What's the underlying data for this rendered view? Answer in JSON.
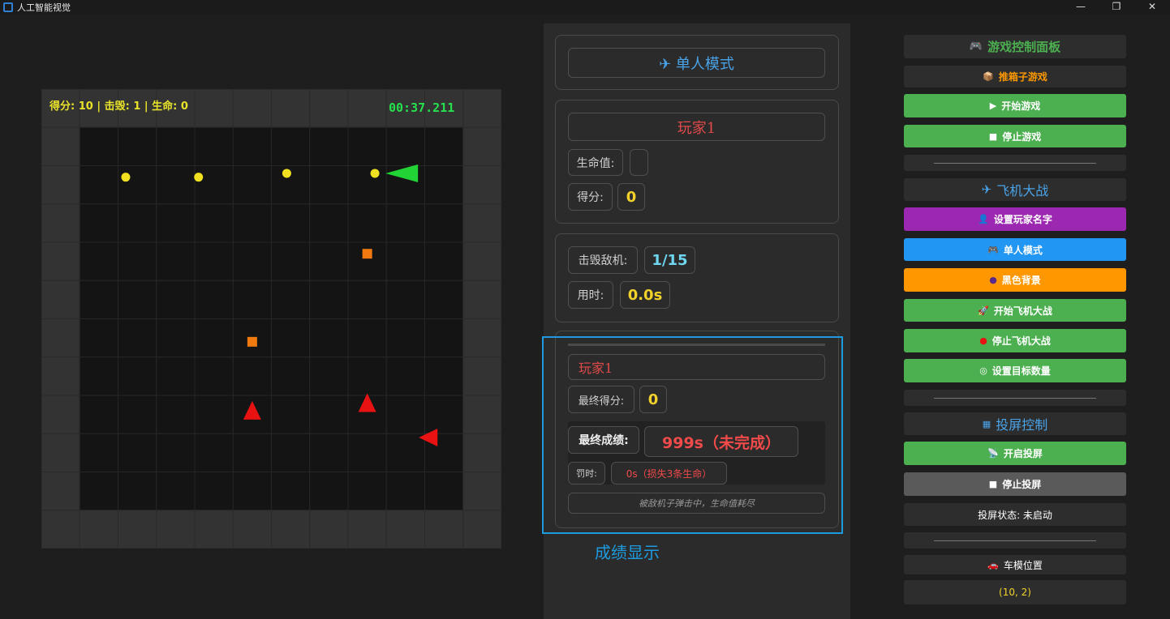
{
  "window": {
    "title": "人工智能视觉",
    "controls": [
      "—",
      "❐",
      "✕"
    ]
  },
  "hud": {
    "score_text": "得分: 10 | 击毁: 1 | 生命: 0",
    "timer": "00:37.211"
  },
  "game": {
    "grid_cells": 12,
    "player_ship": {
      "col": 9.4,
      "row": 2.2,
      "color": "#22d335",
      "facing": "left"
    },
    "yellow_bullets": [
      {
        "col": 2.2,
        "row": 2.3
      },
      {
        "col": 4.1,
        "row": 2.3
      },
      {
        "col": 6.4,
        "row": 2.2
      },
      {
        "col": 8.7,
        "row": 2.2
      }
    ],
    "orange_blocks": [
      {
        "col": 8.5,
        "row": 4.3
      },
      {
        "col": 5.5,
        "row": 6.6
      }
    ],
    "red_enemies": [
      {
        "col": 5.5,
        "row": 8.4,
        "facing": "up"
      },
      {
        "col": 8.5,
        "row": 8.2,
        "facing": "up"
      },
      {
        "col": 10.1,
        "row": 9.1,
        "facing": "left"
      }
    ],
    "colors": {
      "cell_dark": "#141414",
      "cell_border": "#333333",
      "outer": "#333333",
      "bullet": "#f0e020",
      "block": "#f07a10",
      "enemy": "#e81212"
    }
  },
  "mode_card": {
    "title": "✈ 单人模式"
  },
  "player_card": {
    "name": "玩家1",
    "hp_label": "生命值:",
    "hp_value": "",
    "score_label": "得分:",
    "score_value": "0"
  },
  "stats_card": {
    "kills_label": "击毁敌机:",
    "kills_value": "1/15",
    "time_label": "用时:",
    "time_value": "0.0s"
  },
  "result_card": {
    "name": "玩家1",
    "final_score_label": "最终得分:",
    "final_score_value": "0",
    "final_result_label": "最终成绩:",
    "final_result_value": "999s（未完成）",
    "penalty_label": "罚时:",
    "penalty_value": "0s（损失3条生命）",
    "note": "被敌机子弹击中，生命值耗尽"
  },
  "caption": "成绩显示",
  "right_panel": {
    "game_control_title": "游戏控制面板",
    "sokoban": "推箱子游戏",
    "start_game": "开始游戏",
    "stop_game": "停止游戏",
    "plane_war_title": "飞机大战",
    "set_player_name": "设置玩家名字",
    "single_mode": "单人模式",
    "black_bg": "黑色背景",
    "start_plane_war": "开始飞机大战",
    "stop_plane_war": "停止飞机大战",
    "set_target_count": "设置目标数量",
    "cast_title": "投屏控制",
    "start_cast": "开启投屏",
    "stop_cast": "停止投屏",
    "cast_status": "投屏状态: 未启动",
    "car_position_title": "车模位置",
    "car_position_value": "(10, 2)"
  }
}
